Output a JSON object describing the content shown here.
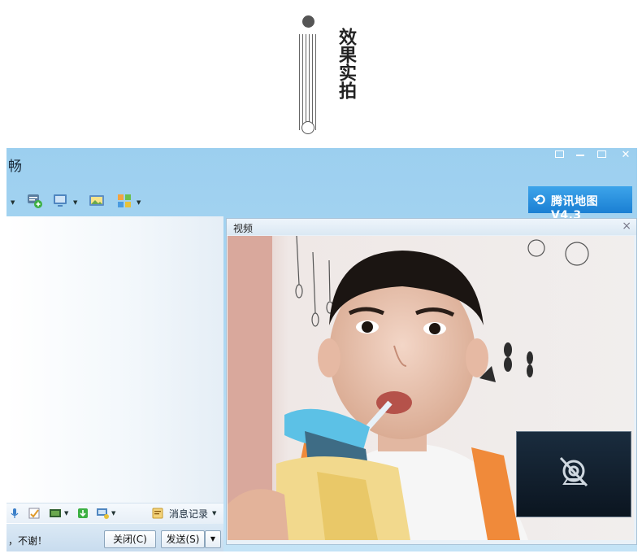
{
  "header": {
    "title": "效果实拍"
  },
  "window": {
    "title_fragment": "畅",
    "controls": {
      "restore": "▭",
      "minimize": "—",
      "maximize": "□",
      "close": "✕"
    }
  },
  "ad": {
    "text": "腾讯地图 V4.3"
  },
  "chat": {
    "history_label": "消息记录",
    "message_fragment": "，不谢！",
    "close_button": "关闭(C)",
    "send_button": "发送(S)"
  },
  "video": {
    "panel_title": "视频",
    "close_icon": "×"
  },
  "colors": {
    "accent": "#1a7fd3",
    "window_bg": "#a9d6f2"
  }
}
